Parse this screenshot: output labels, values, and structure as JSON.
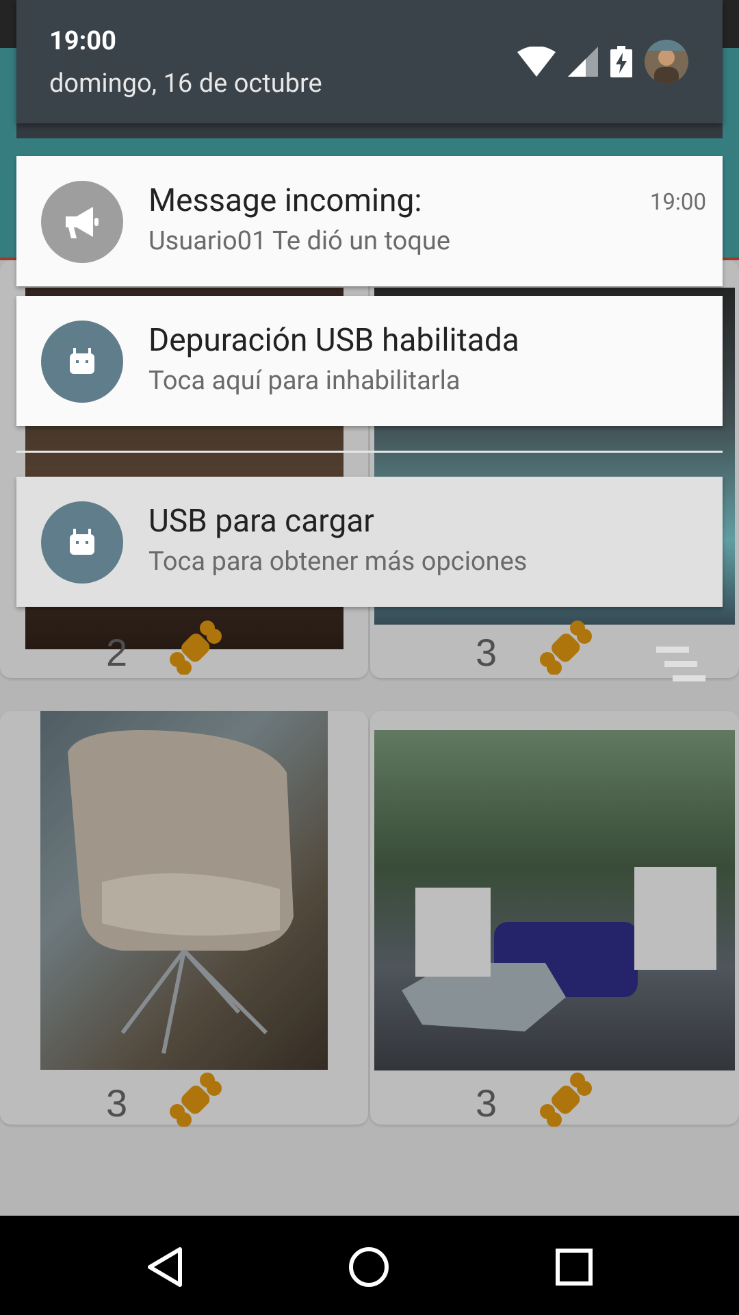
{
  "status_bar": {
    "time": "19:00",
    "date": "domingo, 16 de octubre"
  },
  "notifications": [
    {
      "title": "Message incoming:",
      "text": "Usuario01 Te dió un toque",
      "time": "19:00",
      "icon": "megaphone-icon",
      "icon_bg": "#9e9e9e"
    },
    {
      "title": "Depuración USB habilitada",
      "text": "Toca aquí para inhabilitarla",
      "icon": "android-icon",
      "icon_bg": "#607d8b"
    },
    {
      "title": "USB para cargar",
      "text": "Toca para obtener más opciones",
      "icon": "android-icon",
      "icon_bg": "#607d8b"
    }
  ],
  "cards": [
    {
      "count": "2"
    },
    {
      "count": "3"
    },
    {
      "count": "3"
    },
    {
      "count": "3"
    }
  ],
  "colors": {
    "toolbar": "#3e8f92",
    "bone": "#c8860f",
    "shade_header": "#3a424a"
  }
}
